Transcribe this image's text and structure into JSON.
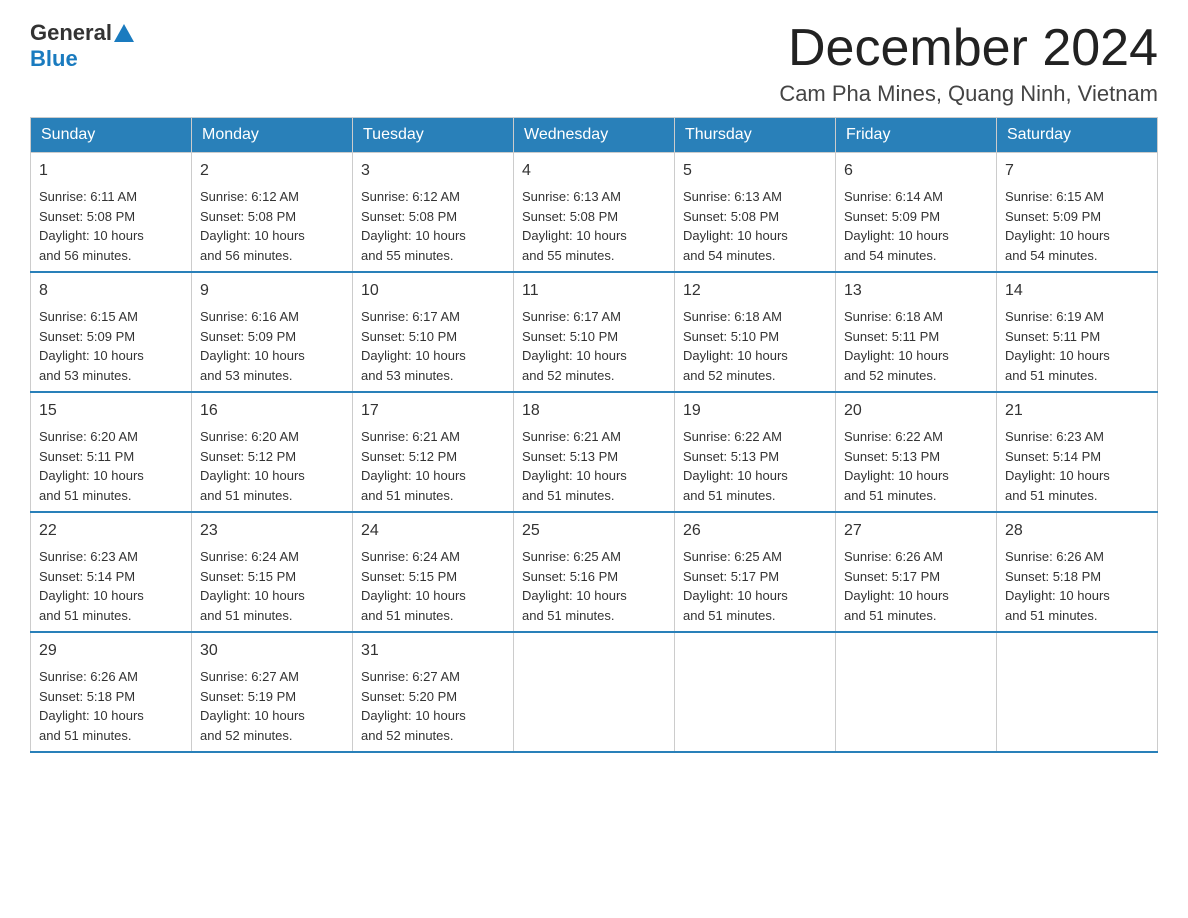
{
  "header": {
    "logo": {
      "general": "General",
      "blue": "Blue"
    },
    "title": "December 2024",
    "location": "Cam Pha Mines, Quang Ninh, Vietnam"
  },
  "weekdays": [
    "Sunday",
    "Monday",
    "Tuesday",
    "Wednesday",
    "Thursday",
    "Friday",
    "Saturday"
  ],
  "weeks": [
    [
      {
        "day": "1",
        "sunrise": "6:11 AM",
        "sunset": "5:08 PM",
        "daylight": "10 hours and 56 minutes."
      },
      {
        "day": "2",
        "sunrise": "6:12 AM",
        "sunset": "5:08 PM",
        "daylight": "10 hours and 56 minutes."
      },
      {
        "day": "3",
        "sunrise": "6:12 AM",
        "sunset": "5:08 PM",
        "daylight": "10 hours and 55 minutes."
      },
      {
        "day": "4",
        "sunrise": "6:13 AM",
        "sunset": "5:08 PM",
        "daylight": "10 hours and 55 minutes."
      },
      {
        "day": "5",
        "sunrise": "6:13 AM",
        "sunset": "5:08 PM",
        "daylight": "10 hours and 54 minutes."
      },
      {
        "day": "6",
        "sunrise": "6:14 AM",
        "sunset": "5:09 PM",
        "daylight": "10 hours and 54 minutes."
      },
      {
        "day": "7",
        "sunrise": "6:15 AM",
        "sunset": "5:09 PM",
        "daylight": "10 hours and 54 minutes."
      }
    ],
    [
      {
        "day": "8",
        "sunrise": "6:15 AM",
        "sunset": "5:09 PM",
        "daylight": "10 hours and 53 minutes."
      },
      {
        "day": "9",
        "sunrise": "6:16 AM",
        "sunset": "5:09 PM",
        "daylight": "10 hours and 53 minutes."
      },
      {
        "day": "10",
        "sunrise": "6:17 AM",
        "sunset": "5:10 PM",
        "daylight": "10 hours and 53 minutes."
      },
      {
        "day": "11",
        "sunrise": "6:17 AM",
        "sunset": "5:10 PM",
        "daylight": "10 hours and 52 minutes."
      },
      {
        "day": "12",
        "sunrise": "6:18 AM",
        "sunset": "5:10 PM",
        "daylight": "10 hours and 52 minutes."
      },
      {
        "day": "13",
        "sunrise": "6:18 AM",
        "sunset": "5:11 PM",
        "daylight": "10 hours and 52 minutes."
      },
      {
        "day": "14",
        "sunrise": "6:19 AM",
        "sunset": "5:11 PM",
        "daylight": "10 hours and 51 minutes."
      }
    ],
    [
      {
        "day": "15",
        "sunrise": "6:20 AM",
        "sunset": "5:11 PM",
        "daylight": "10 hours and 51 minutes."
      },
      {
        "day": "16",
        "sunrise": "6:20 AM",
        "sunset": "5:12 PM",
        "daylight": "10 hours and 51 minutes."
      },
      {
        "day": "17",
        "sunrise": "6:21 AM",
        "sunset": "5:12 PM",
        "daylight": "10 hours and 51 minutes."
      },
      {
        "day": "18",
        "sunrise": "6:21 AM",
        "sunset": "5:13 PM",
        "daylight": "10 hours and 51 minutes."
      },
      {
        "day": "19",
        "sunrise": "6:22 AM",
        "sunset": "5:13 PM",
        "daylight": "10 hours and 51 minutes."
      },
      {
        "day": "20",
        "sunrise": "6:22 AM",
        "sunset": "5:13 PM",
        "daylight": "10 hours and 51 minutes."
      },
      {
        "day": "21",
        "sunrise": "6:23 AM",
        "sunset": "5:14 PM",
        "daylight": "10 hours and 51 minutes."
      }
    ],
    [
      {
        "day": "22",
        "sunrise": "6:23 AM",
        "sunset": "5:14 PM",
        "daylight": "10 hours and 51 minutes."
      },
      {
        "day": "23",
        "sunrise": "6:24 AM",
        "sunset": "5:15 PM",
        "daylight": "10 hours and 51 minutes."
      },
      {
        "day": "24",
        "sunrise": "6:24 AM",
        "sunset": "5:15 PM",
        "daylight": "10 hours and 51 minutes."
      },
      {
        "day": "25",
        "sunrise": "6:25 AM",
        "sunset": "5:16 PM",
        "daylight": "10 hours and 51 minutes."
      },
      {
        "day": "26",
        "sunrise": "6:25 AM",
        "sunset": "5:17 PM",
        "daylight": "10 hours and 51 minutes."
      },
      {
        "day": "27",
        "sunrise": "6:26 AM",
        "sunset": "5:17 PM",
        "daylight": "10 hours and 51 minutes."
      },
      {
        "day": "28",
        "sunrise": "6:26 AM",
        "sunset": "5:18 PM",
        "daylight": "10 hours and 51 minutes."
      }
    ],
    [
      {
        "day": "29",
        "sunrise": "6:26 AM",
        "sunset": "5:18 PM",
        "daylight": "10 hours and 51 minutes."
      },
      {
        "day": "30",
        "sunrise": "6:27 AM",
        "sunset": "5:19 PM",
        "daylight": "10 hours and 52 minutes."
      },
      {
        "day": "31",
        "sunrise": "6:27 AM",
        "sunset": "5:20 PM",
        "daylight": "10 hours and 52 minutes."
      },
      null,
      null,
      null,
      null
    ]
  ],
  "labels": {
    "sunrise": "Sunrise:",
    "sunset": "Sunset:",
    "daylight": "Daylight:"
  }
}
